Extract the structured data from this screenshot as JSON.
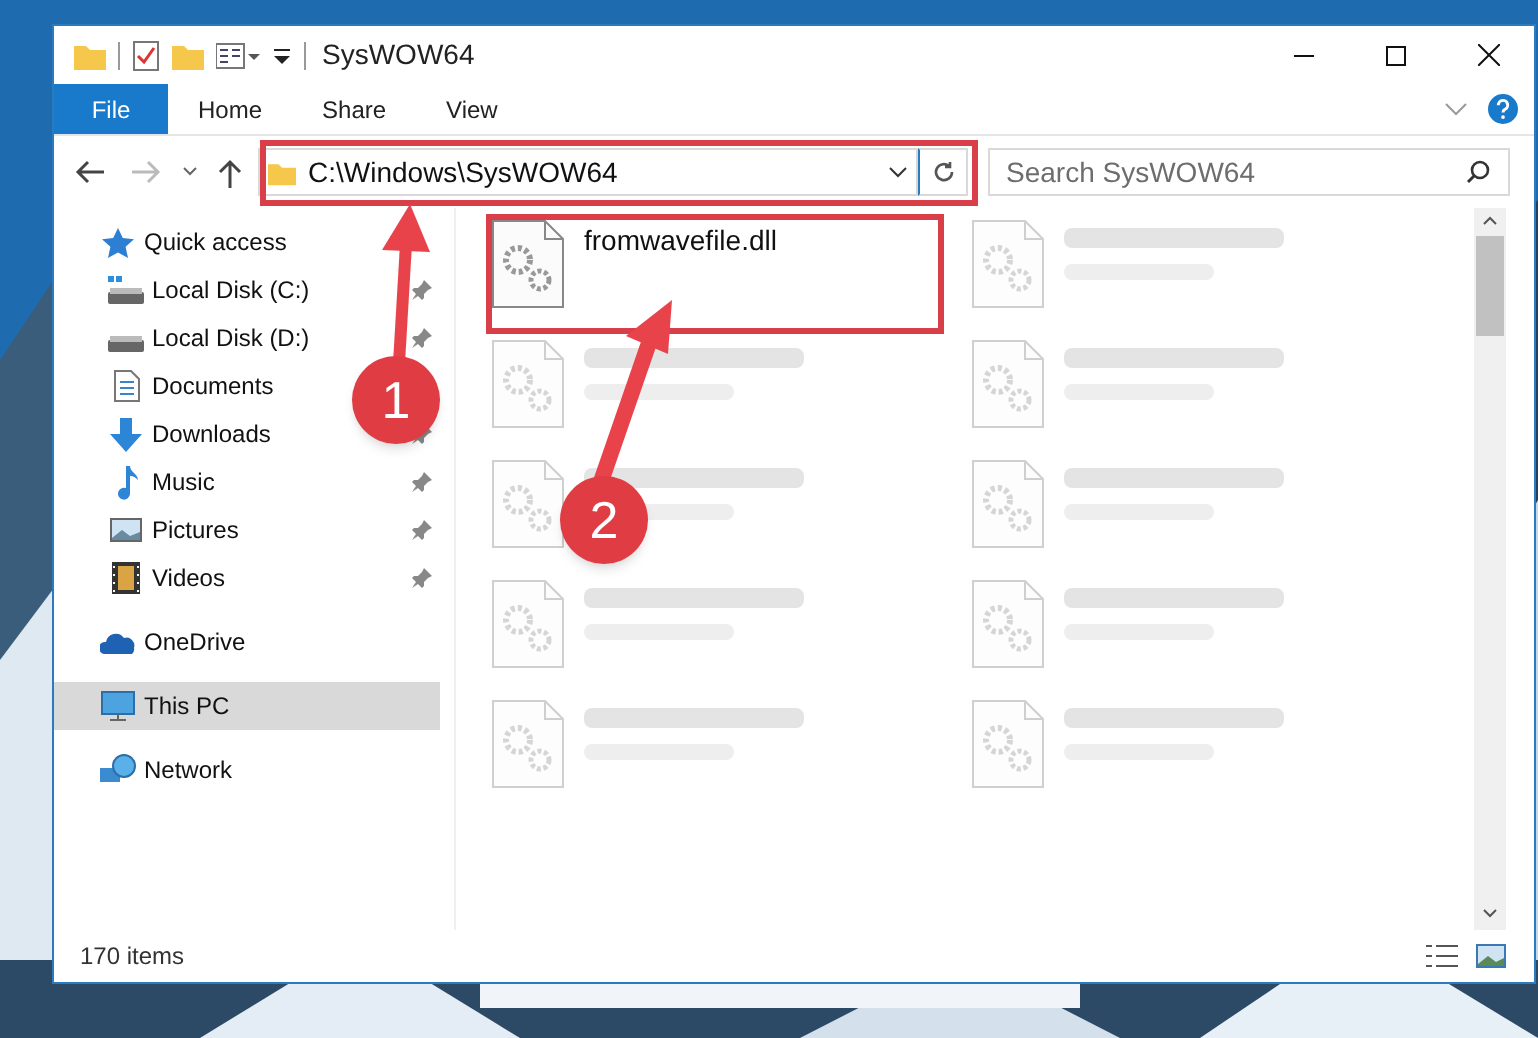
{
  "window": {
    "title": "SysWOW64"
  },
  "ribbon_tabs": [
    {
      "label": "File",
      "selected": true
    },
    {
      "label": "Home",
      "selected": false
    },
    {
      "label": "Share",
      "selected": false
    },
    {
      "label": "View",
      "selected": false
    }
  ],
  "address": {
    "path": "C:\\Windows\\SysWOW64"
  },
  "search": {
    "placeholder": "Search SysWOW64"
  },
  "navigation": [
    {
      "label": "Quick access",
      "selected": false,
      "children": [
        {
          "label": "Local Disk (C:)",
          "selected": false,
          "pinned": true
        },
        {
          "label": "Local Disk (D:)",
          "selected": false,
          "pinned": true
        },
        {
          "label": "Documents",
          "selected": false
        },
        {
          "label": "Downloads",
          "selected": false,
          "pinned": true
        },
        {
          "label": "Music",
          "selected": false,
          "pinned": true
        },
        {
          "label": "Pictures",
          "selected": false,
          "pinned": true
        },
        {
          "label": "Videos",
          "selected": false,
          "pinned": true
        }
      ]
    },
    {
      "label": "OneDrive",
      "selected": false
    },
    {
      "label": "This PC",
      "selected": true
    },
    {
      "label": "Network",
      "selected": false
    }
  ],
  "files": [
    {
      "name": "fromwavefile.dll",
      "blurred": false
    },
    {
      "blurred": true
    },
    {
      "blurred": true
    },
    {
      "blurred": true
    },
    {
      "blurred": true
    },
    {
      "blurred": true
    },
    {
      "blurred": true
    },
    {
      "blurred": true
    },
    {
      "blurred": true
    },
    {
      "blurred": true
    }
  ],
  "status_bar": {
    "item_count": "170 items"
  },
  "annotations": [
    {
      "label": "1"
    },
    {
      "label": "2"
    }
  ]
}
